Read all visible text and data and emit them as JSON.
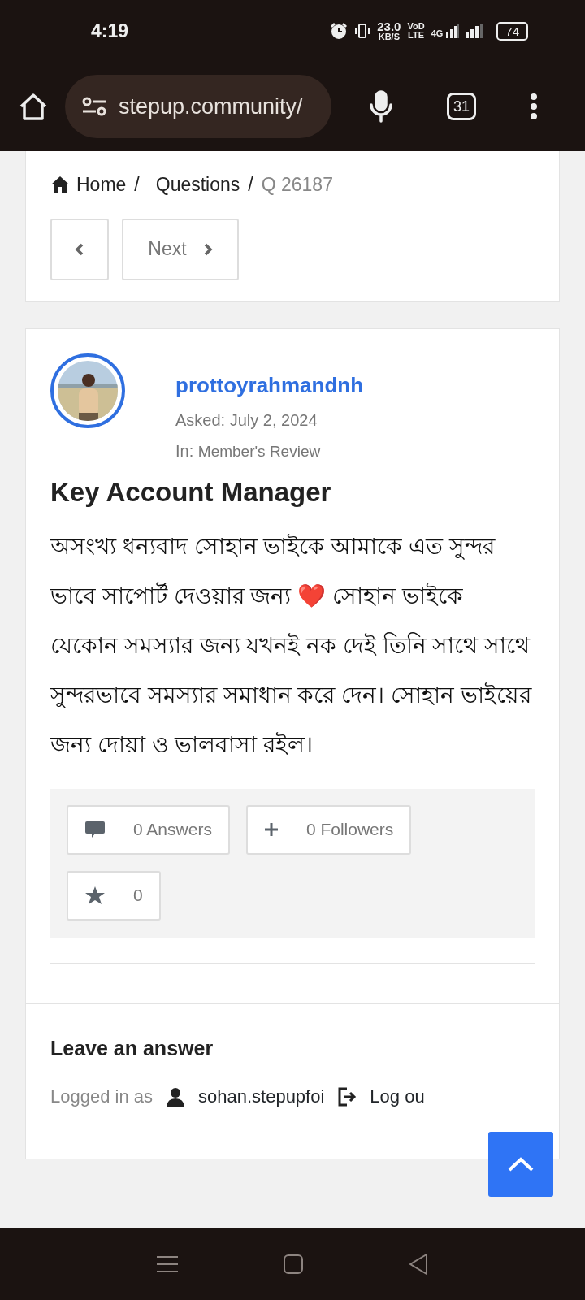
{
  "status_bar": {
    "time": "4:19",
    "speed": "23.0",
    "speed_unit": "KB/S",
    "volte_top": "VoD",
    "volte_bottom": "LTE",
    "network": "4G",
    "battery": "74"
  },
  "browser": {
    "url": "stepup.community/",
    "tab_count": "31"
  },
  "breadcrumb_separator": "/",
  "breadcrumb": [
    {
      "label": "Home",
      "kind": "home"
    },
    {
      "label": "Questions",
      "kind": "link"
    },
    {
      "label": "Q 26187",
      "kind": "current"
    }
  ],
  "pager": {
    "next": "Next"
  },
  "question": {
    "author": "prottoyrahmandnh",
    "asked_label": "Asked:",
    "asked_date": "July 2, 2024",
    "in_label": "In:",
    "category": "Member's Review",
    "title": "Key Account Manager",
    "body": "অসংখ্য ধন্যবাদ সোহান ভাইকে আমাকে এত সুন্দর ভাবে সাপোর্ট দেওয়ার জন্য ❤️ সোহান ভাইকে যেকোন সমস্যার জন্য যখনই নক দেই তিনি সাথে সাথে সুন্দরভাবে সমস্যার সমাধান করে দেন। সোহান ভাইয়ের জন্য দোয়া ও ভালবাসা রইল।",
    "stats": [
      {
        "kind": "answers",
        "count": "0",
        "label": "Answers"
      },
      {
        "kind": "followers",
        "count": "0",
        "label": "Followers"
      },
      {
        "kind": "favorites",
        "count": "0"
      }
    ]
  },
  "answer_form": {
    "heading": "Leave an answer",
    "logged_in_label": "Logged in as",
    "username": "sohan.stepupfoi",
    "logout": "Log ou"
  }
}
